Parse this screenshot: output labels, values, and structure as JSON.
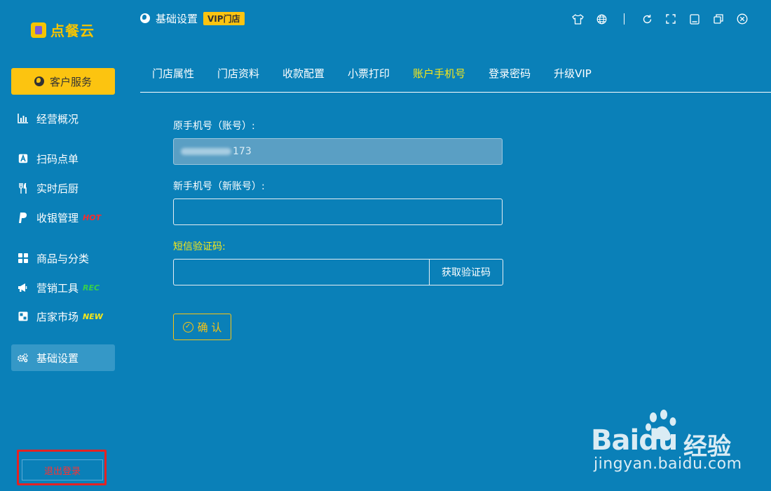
{
  "app": {
    "logo_text": "点餐云",
    "service_label": "客户服务"
  },
  "header": {
    "title": "基础设置",
    "vip_badge": "VIP门店"
  },
  "sidebar": {
    "items": [
      {
        "label": "经营概况",
        "icon": "bar-chart-icon",
        "badge": ""
      },
      {
        "label": "扫码点单",
        "icon": "scan-icon",
        "badge": ""
      },
      {
        "label": "实时后厨",
        "icon": "utensils-icon",
        "badge": ""
      },
      {
        "label": "收银管理",
        "icon": "cashier-icon",
        "badge": "HOT"
      },
      {
        "label": "商品与分类",
        "icon": "grid-icon",
        "badge": ""
      },
      {
        "label": "营销工具",
        "icon": "megaphone-icon",
        "badge": "REC"
      },
      {
        "label": "店家市场",
        "icon": "market-icon",
        "badge": "NEW"
      },
      {
        "label": "基础设置",
        "icon": "gears-icon",
        "badge": ""
      }
    ],
    "logout_label": "退出登录"
  },
  "tabs": [
    {
      "label": "门店属性"
    },
    {
      "label": "门店资料"
    },
    {
      "label": "收款配置"
    },
    {
      "label": "小票打印"
    },
    {
      "label": "账户手机号",
      "active": true
    },
    {
      "label": "登录密码"
    },
    {
      "label": "升级VIP"
    }
  ],
  "form": {
    "old_phone_label": "原手机号（账号）:",
    "old_phone_value_visible": "173",
    "new_phone_label": "新手机号（新账号）:",
    "new_phone_value": "",
    "sms_label": "短信验证码:",
    "sms_value": "",
    "get_code_label": "获取验证码",
    "confirm_label": "确 认"
  },
  "watermark": {
    "brand": "Baidu",
    "brand_cn": "经验",
    "url": "jingyan.baidu.com"
  },
  "colors": {
    "background": "#0a80b8",
    "accent_yellow": "#fcc410",
    "active_tab": "#f8e818",
    "hot": "#ff2a2a",
    "rec": "#38d04a",
    "new": "#f8e818",
    "logout_outline": "#e52222"
  }
}
